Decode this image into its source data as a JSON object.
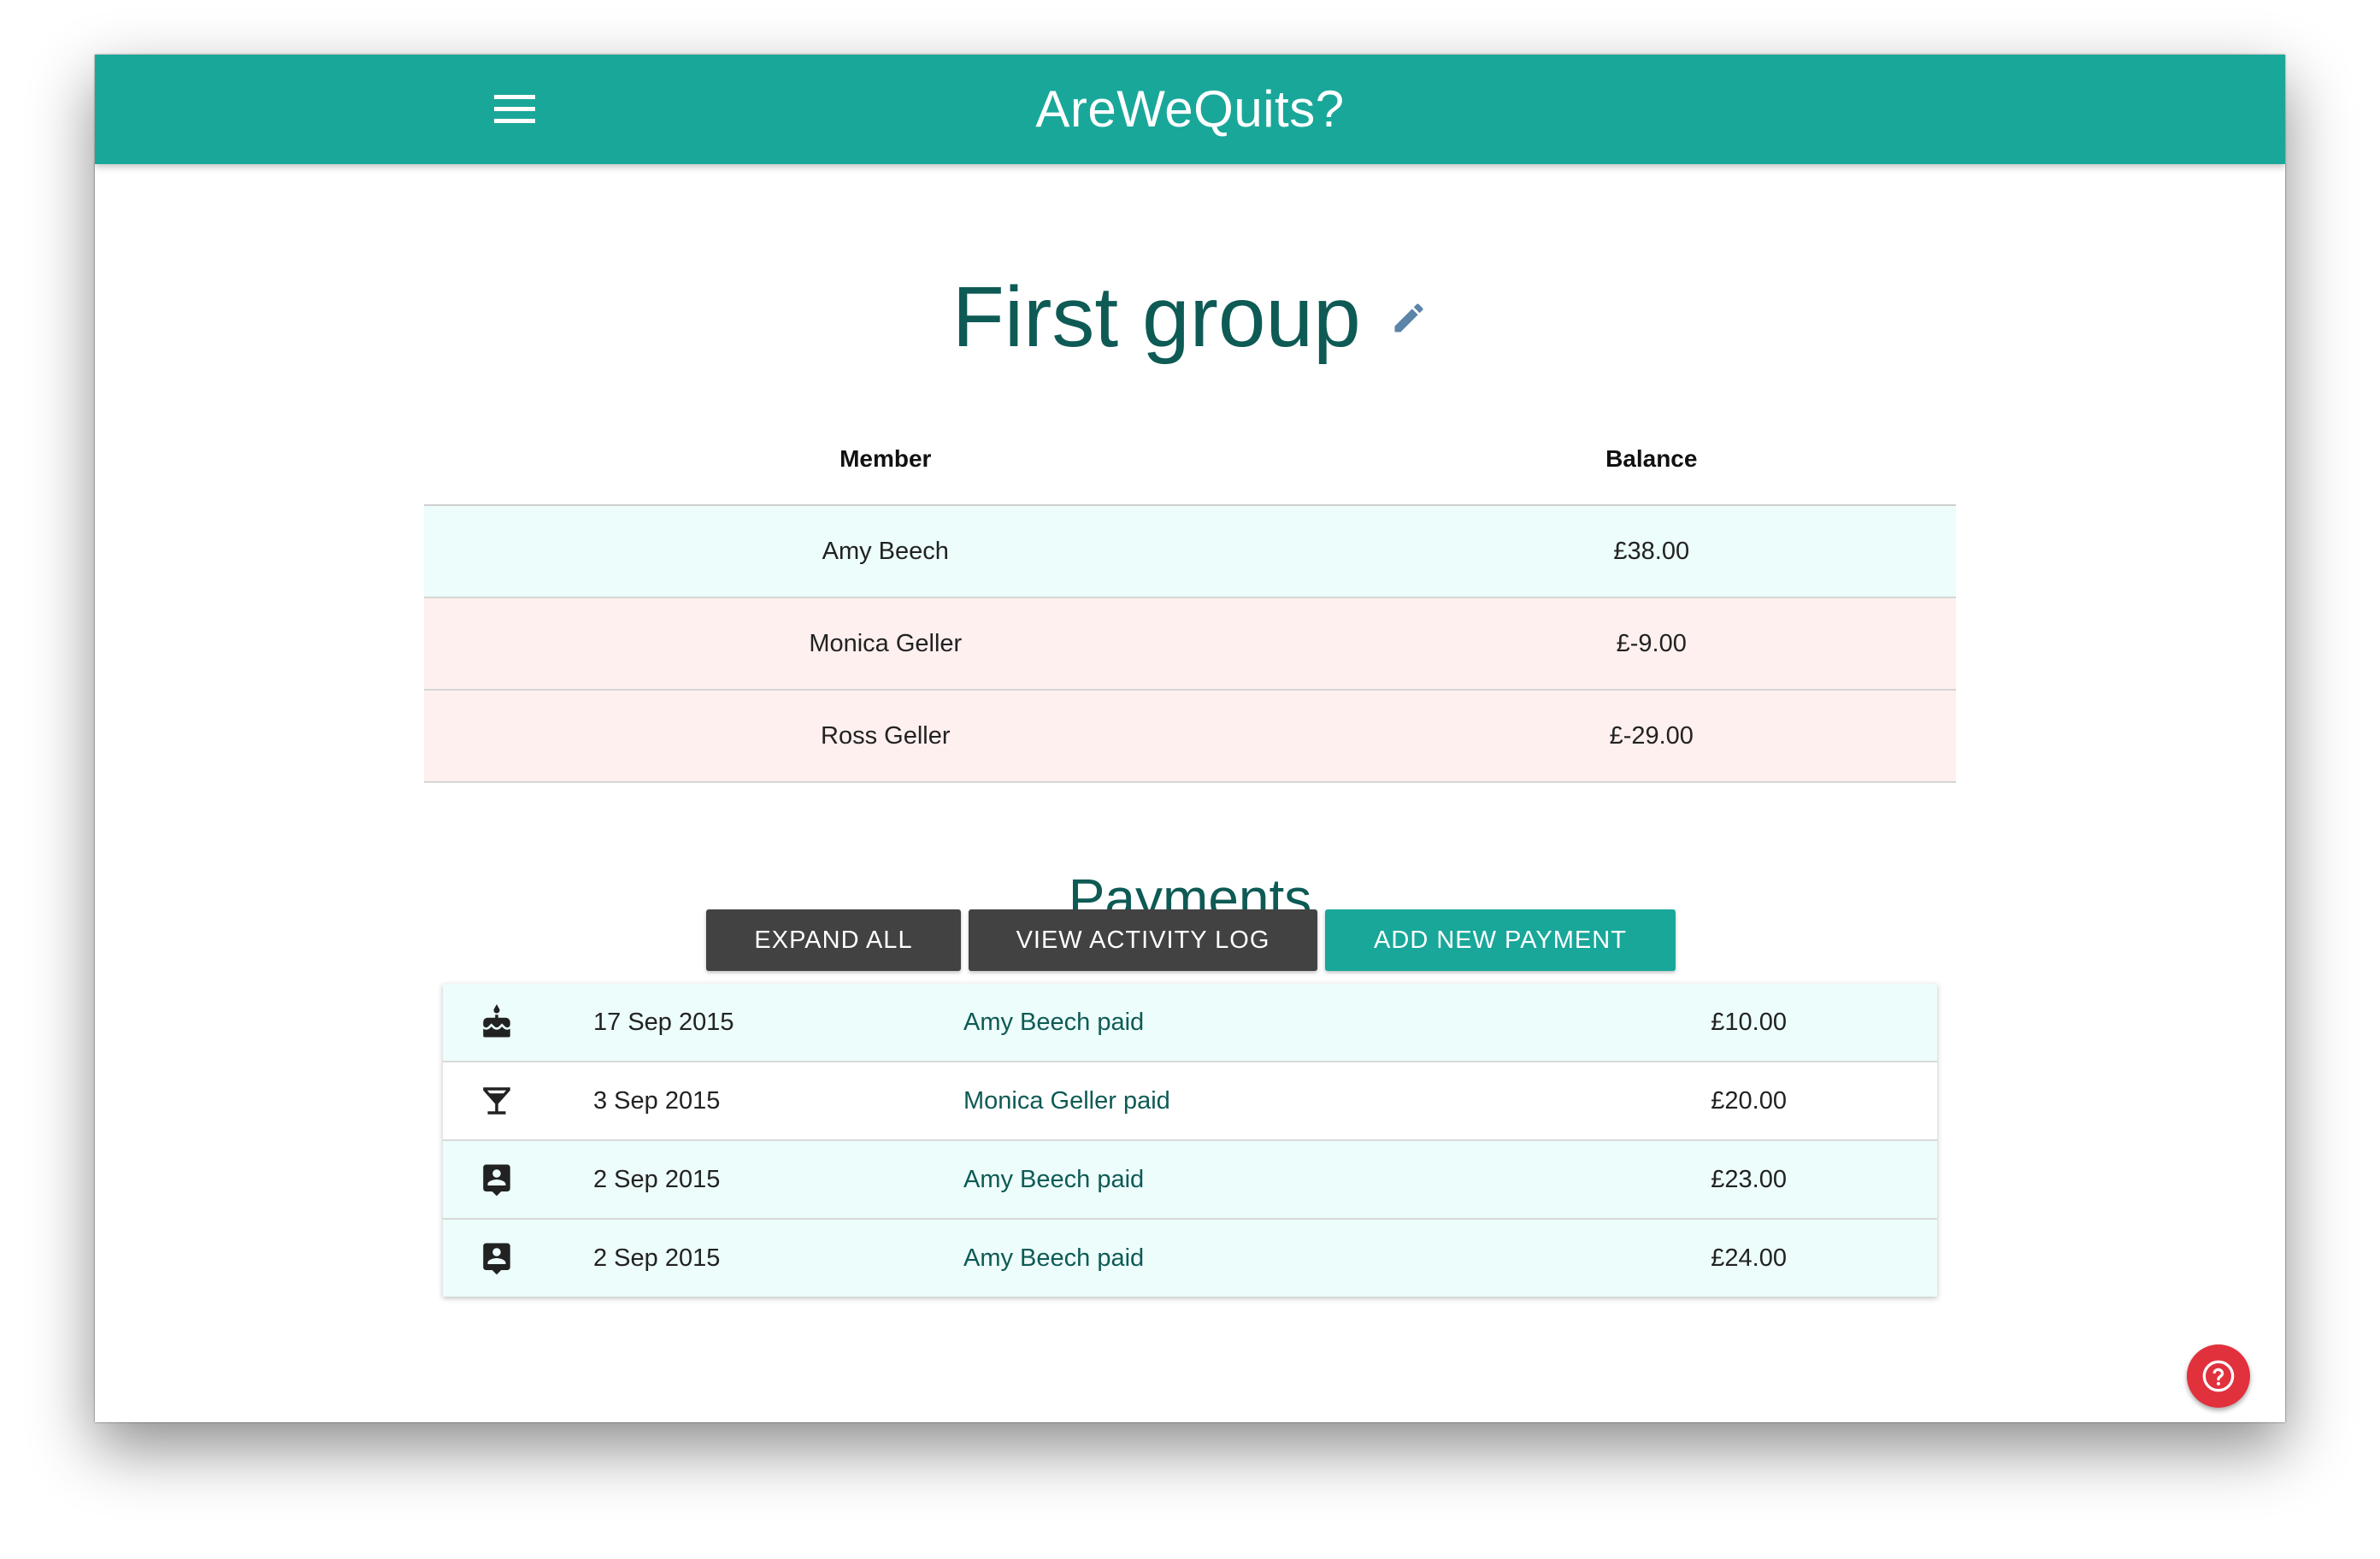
{
  "header": {
    "app_title": "AreWeQuits?",
    "menu_icon": "menu-icon",
    "color": "#19a79a"
  },
  "group": {
    "title": "First group",
    "edit_icon": "pencil-icon"
  },
  "members_table": {
    "columns": [
      "Member",
      "Balance"
    ],
    "rows": [
      {
        "member": "Amy Beech",
        "balance": "£38.00",
        "status": "positive"
      },
      {
        "member": "Monica Geller",
        "balance": "£-9.00",
        "status": "negative"
      },
      {
        "member": "Ross Geller",
        "balance": "£-29.00",
        "status": "negative"
      }
    ],
    "positive_color": "#ecfdfb",
    "negative_color": "#fef0ef"
  },
  "payments": {
    "title": "Payments",
    "buttons": {
      "expand_all": "EXPAND ALL",
      "view_activity_log": "VIEW ACTIVITY LOG",
      "add_new_payment": "ADD NEW PAYMENT"
    },
    "items": [
      {
        "icon": "cake-icon",
        "date": "17 Sep 2015",
        "description": "Amy Beech paid",
        "amount": "£10.00"
      },
      {
        "icon": "cocktail-icon",
        "date": "3 Sep 2015",
        "description": "Monica Geller paid",
        "amount": "£20.00"
      },
      {
        "icon": "contact-icon",
        "date": "2 Sep 2015",
        "description": "Amy Beech paid",
        "amount": "£23.00"
      },
      {
        "icon": "contact-icon",
        "date": "2 Sep 2015",
        "description": "Amy Beech paid",
        "amount": "£24.00"
      }
    ]
  },
  "help_button": {
    "icon": "help-icon",
    "color": "#e0313d"
  }
}
